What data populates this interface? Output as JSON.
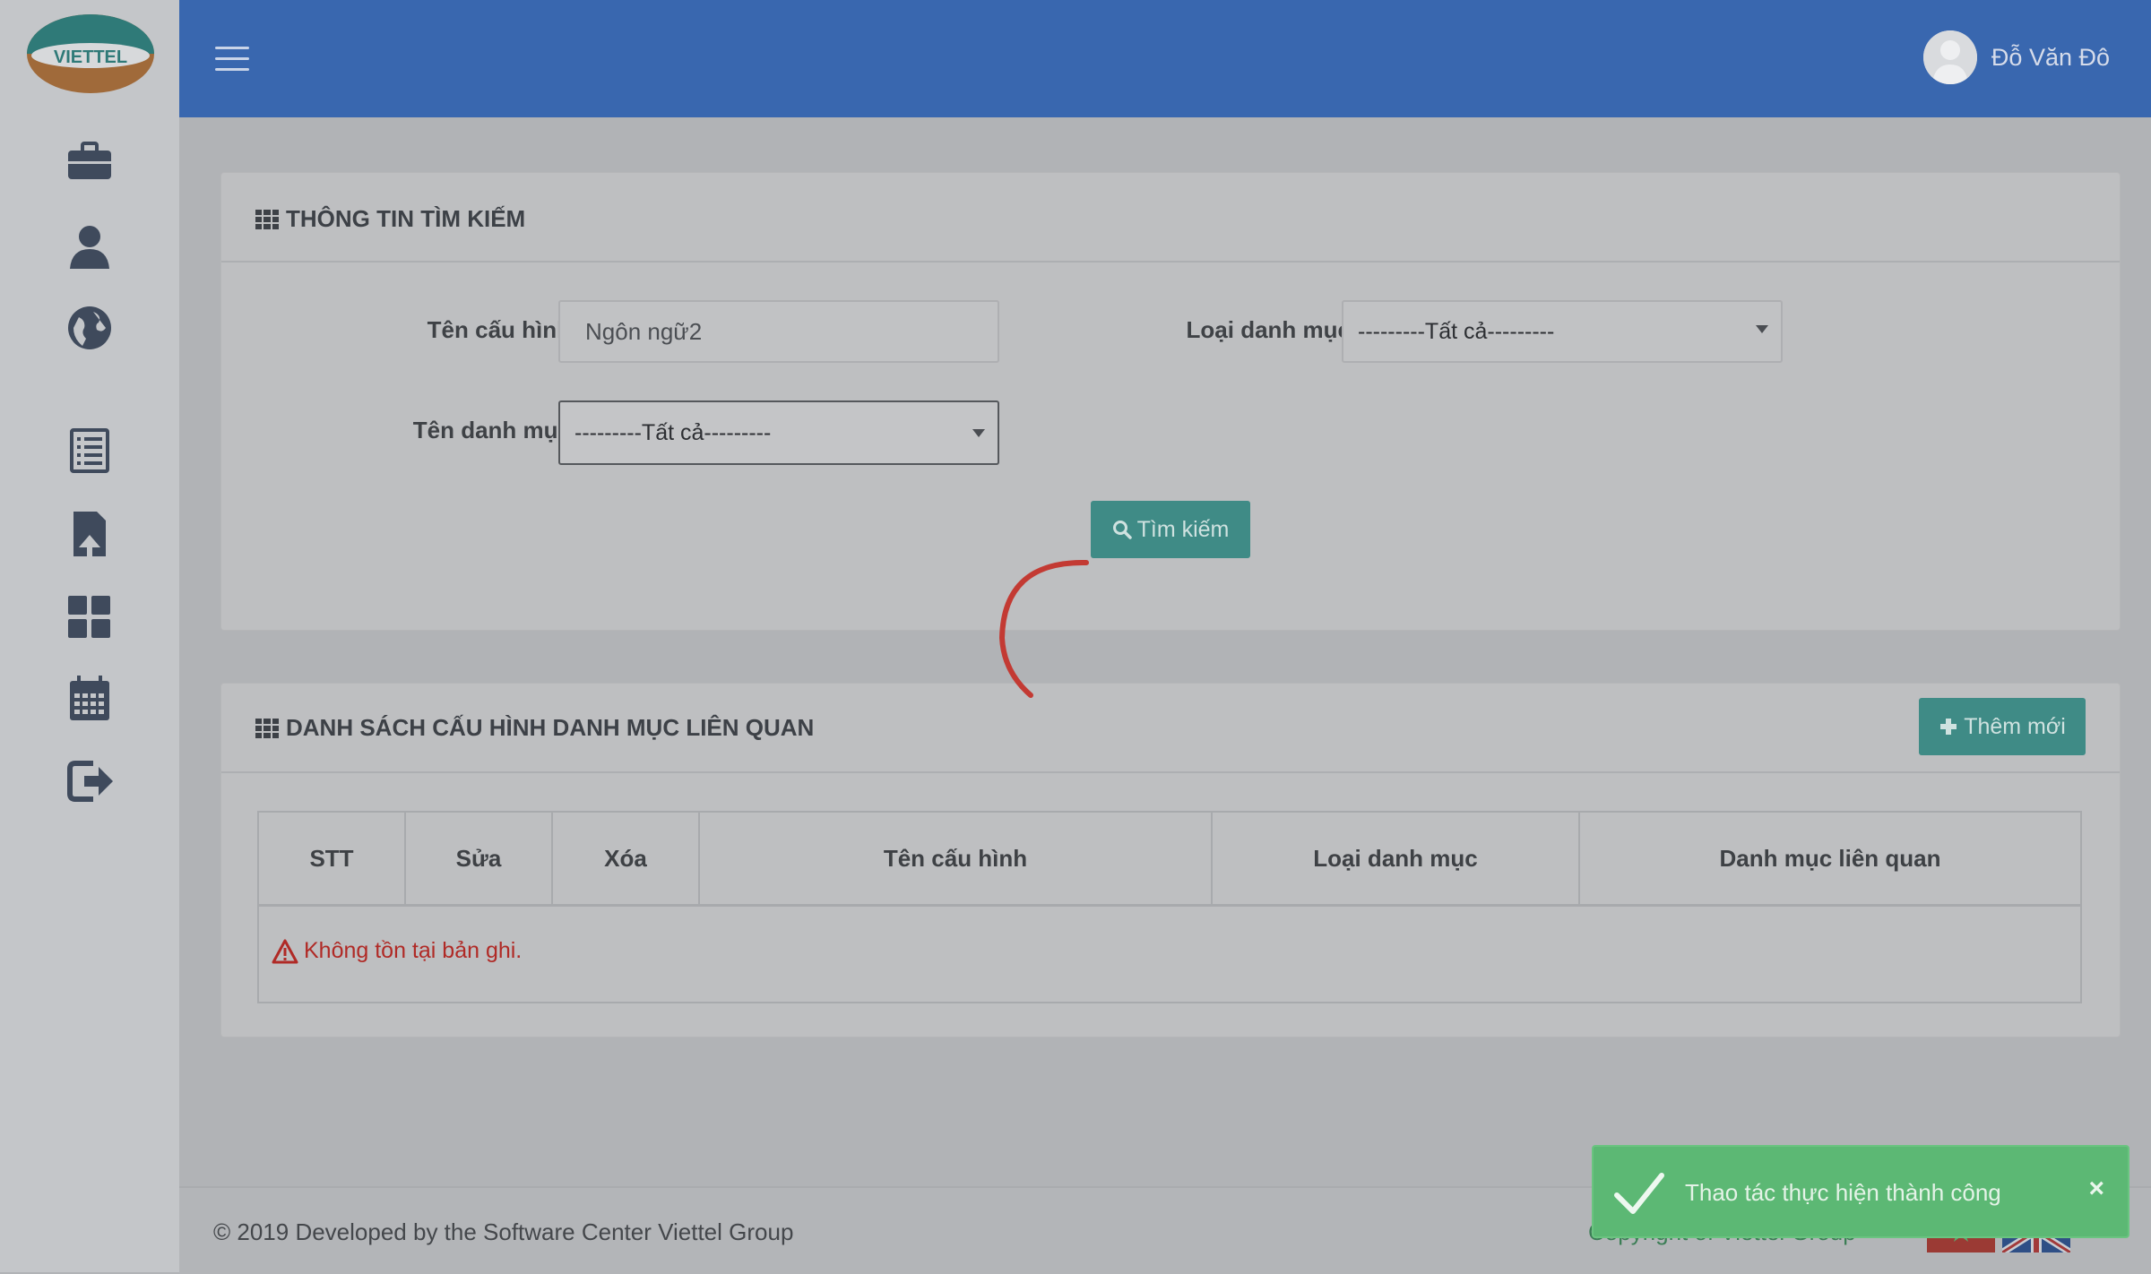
{
  "header": {
    "menu_icon": "hamburger-icon",
    "user_name": "Đỗ Văn Đô",
    "brand_color": "#3967af"
  },
  "sidebar": {
    "logo_text": "VIETTEL",
    "items": [
      {
        "icon": "briefcase-icon"
      },
      {
        "icon": "user-icon"
      },
      {
        "icon": "globe-icon"
      },
      {
        "icon": "list-icon"
      },
      {
        "icon": "file-upload-icon"
      },
      {
        "icon": "dashboard-icon"
      },
      {
        "icon": "calendar-icon"
      },
      {
        "icon": "logout-icon"
      }
    ]
  },
  "search_panel": {
    "title": "THÔNG TIN TÌM KIẾM",
    "fields": {
      "config_name_label": "Tên cấu hình",
      "config_name_value": "Ngôn ngữ2",
      "category_type_label": "Loại danh mục",
      "category_type_value": "---------Tất cả---------",
      "category_name_label": "Tên danh mục",
      "category_name_value": "---------Tất cả---------"
    },
    "search_button": "Tìm kiếm"
  },
  "list_panel": {
    "title": "DANH SÁCH CẤU HÌNH DANH MỤC LIÊN QUAN",
    "add_button": "Thêm mới",
    "columns": [
      "STT",
      "Sửa",
      "Xóa",
      "Tên cấu hình",
      "Loại danh mục",
      "Danh mục liên quan"
    ],
    "empty_message": "Không tồn tại bản ghi."
  },
  "footer": {
    "copyright": "© 2019 Developed by the Software Center Viettel Group",
    "copyright_right": "Copyright of Viettel Group"
  },
  "toast": {
    "message": "Thao tác thực hiện thành công",
    "close": "×",
    "color": "#5cb874"
  },
  "accent_color": "#3f8b86"
}
